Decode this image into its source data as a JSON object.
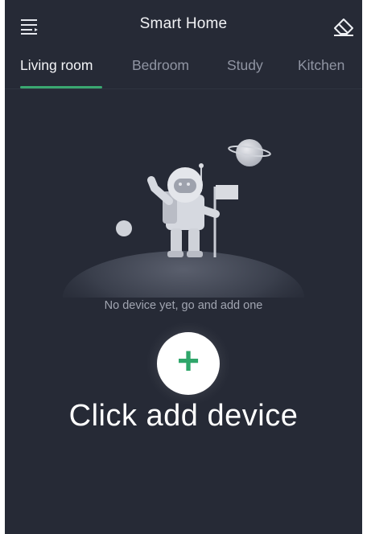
{
  "header": {
    "title": "Smart Home",
    "menu_icon": "menu-icon",
    "erase_icon": "eraser-icon"
  },
  "tabs": [
    {
      "label": "Living room",
      "active": true
    },
    {
      "label": "Bedroom",
      "active": false
    },
    {
      "label": "Study",
      "active": false
    },
    {
      "label": "Kitchen",
      "active": false
    }
  ],
  "empty_state": {
    "message": "No device yet, go and add one",
    "illustration": "astronaut-illustration"
  },
  "add_button": {
    "icon": "plus-icon"
  },
  "overlay": {
    "caption": "Click add device"
  },
  "colors": {
    "background": "#262a36",
    "accent": "#3aa871",
    "text_primary": "#f1f2f5",
    "text_muted": "#9095a3"
  }
}
